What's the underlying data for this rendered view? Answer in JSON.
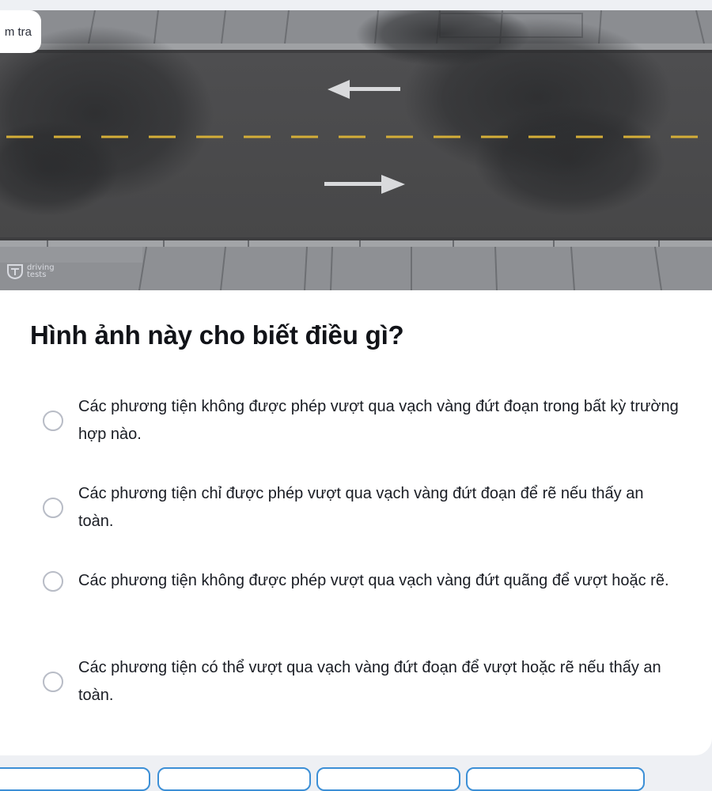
{
  "header": {
    "tag_label": "m tra"
  },
  "image": {
    "watermark_text": "driving tests",
    "colors": {
      "asphalt": "#4b4b4b",
      "sidewalk": "#8a8c90",
      "dashed_line": "#d6b03a",
      "arrow": "#d9dadc"
    }
  },
  "question": {
    "title": "Hình ảnh này cho biết điều gì?"
  },
  "options": [
    {
      "text": "Các phương tiện không được phép vượt qua vạch vàng đứt đoạn trong bất kỳ trường hợp nào."
    },
    {
      "text": "Các phương tiện chỉ được phép vượt qua vạch vàng đứt đoạn để rẽ nếu thấy an toàn."
    },
    {
      "text": "Các phương tiện không được phép vượt qua vạch vàng đứt quãng để vượt hoặc rẽ."
    },
    {
      "text": "Các phương tiện có thể vượt qua vạch vàng đứt đoạn để vượt hoặc rẽ nếu thấy an toàn."
    }
  ]
}
